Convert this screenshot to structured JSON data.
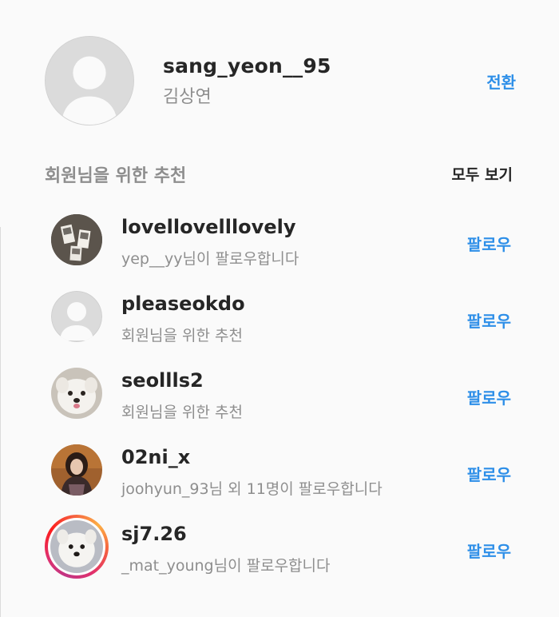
{
  "current_user": {
    "username": "sang_yeon__95",
    "full_name": "김상연",
    "switch_label": "전환"
  },
  "suggestions": {
    "title": "회원님을 위한 추천",
    "see_all_label": "모두 보기",
    "follow_label": "팔로우",
    "items": [
      {
        "username": "lovellovelllovely",
        "subtitle": "yep__yy님이 팔로우합니다",
        "avatar": "photo-booth-avatar"
      },
      {
        "username": "pleaseokdo",
        "subtitle": "회원님을 위한 추천",
        "avatar": "default-avatar"
      },
      {
        "username": "seollls2",
        "subtitle": "회원님을 위한 추천",
        "avatar": "white-dog-avatar"
      },
      {
        "username": "02ni_x",
        "subtitle": "joohyun_93님 외 11명이 팔로우합니다",
        "avatar": "person-avatar"
      },
      {
        "username": "sj7.26",
        "subtitle": "_mat_young님이 팔로우합니다",
        "avatar": "white-dog-story-avatar"
      }
    ]
  },
  "colors": {
    "accent": "#2e8fe8",
    "text_primary": "#262626",
    "text_secondary": "#8e8e8e",
    "background": "#fafafa"
  }
}
